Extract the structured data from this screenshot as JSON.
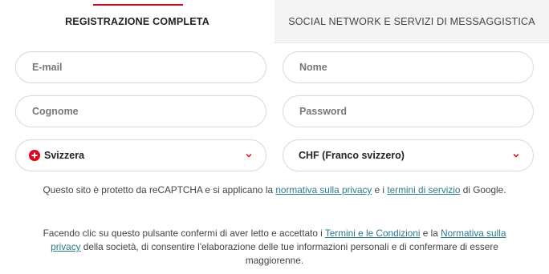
{
  "tabs": {
    "complete": "REGISTRAZIONE COMPLETA",
    "social": "SOCIAL NETWORK E SERVIZI DI MESSAGGISTICA"
  },
  "fields": {
    "email_placeholder": "E-mail",
    "nome_placeholder": "Nome",
    "cognome_placeholder": "Cognome",
    "password_placeholder": "Password"
  },
  "country": {
    "value": "Svizzera",
    "flag_icon": "swiss-flag-icon"
  },
  "currency": {
    "value": "CHF (Franco svizzero)"
  },
  "recaptcha": {
    "text1": "Questo sito è protetto da reCAPTCHA e si applicano la ",
    "privacy_link": "normativa sulla privacy",
    "text2": " e i ",
    "terms_link": "termini di servizio",
    "text3": " di Google."
  },
  "consent": {
    "text1": "Facendo clic su questo pulsante confermi di aver letto e accettato i ",
    "terms_link": "Termini e le Condizioni",
    "text2": " e la ",
    "privacy_link": "Normativa sulla privacy",
    "text3": " della società, di consentire l'elaborazione delle tue informazioni personali e di confermare di essere maggiorenne."
  },
  "colors": {
    "accent": "#e2001a",
    "link": "#2a7a8c",
    "border": "#d8d8d8"
  }
}
